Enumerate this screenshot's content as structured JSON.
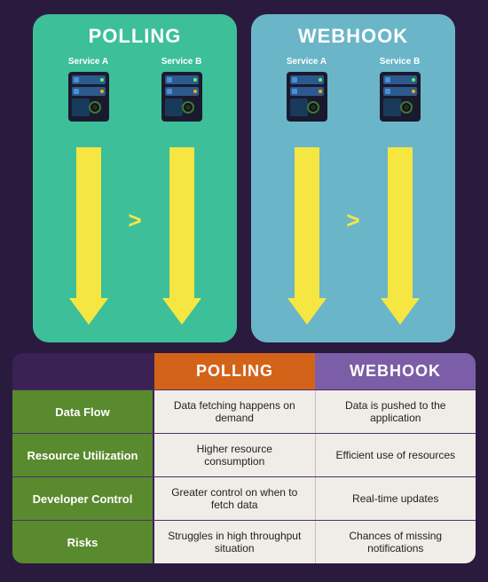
{
  "top": {
    "polling": {
      "title": "POLLING",
      "service_a": "Service A",
      "service_b": "Service B"
    },
    "webhook": {
      "title": "WEBHOOK",
      "service_a": "Service A",
      "service_b": "Service B"
    }
  },
  "table": {
    "header": {
      "empty": "",
      "polling": "POLLING",
      "webhook": "WEBHOOK"
    },
    "rows": [
      {
        "label": "Data Flow",
        "polling": "Data fetching happens on demand",
        "webhook": "Data is pushed to the application"
      },
      {
        "label": "Resource Utilization",
        "polling": "Higher resource consumption",
        "webhook": "Efficient use of resources"
      },
      {
        "label": "Developer Control",
        "polling": "Greater control on when to fetch data",
        "webhook": "Real-time updates"
      },
      {
        "label": "Risks",
        "polling": "Struggles in high throughput situation",
        "webhook": "Chances of missing notifications"
      }
    ]
  }
}
